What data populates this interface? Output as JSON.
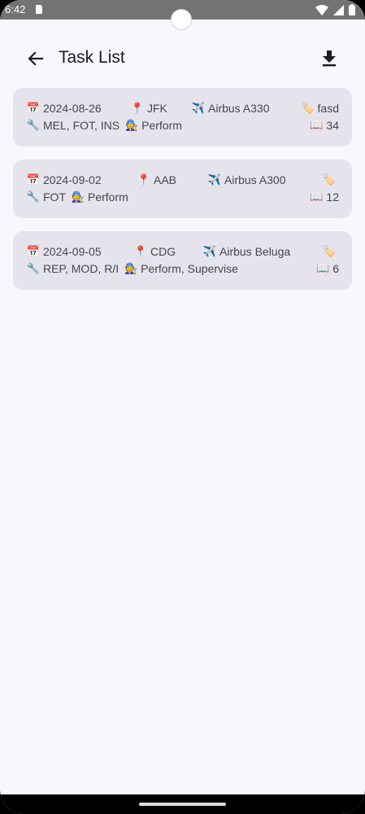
{
  "status_bar": {
    "time": "6:42"
  },
  "app_bar": {
    "title": "Task List",
    "back_icon": "arrow-left-icon",
    "download_icon": "download-icon"
  },
  "tasks": [
    {
      "date": "2024-08-26",
      "location": "JFK",
      "aircraft": "Airbus A330",
      "tag": "fasd",
      "categories": "MEL, FOT, INS",
      "roles": "Perform",
      "reference": "34"
    },
    {
      "date": "2024-09-02",
      "location": "AAB",
      "aircraft": "Airbus A300",
      "tag": "",
      "categories": "FOT",
      "roles": "Perform",
      "reference": "12"
    },
    {
      "date": "2024-09-05",
      "location": "CDG",
      "aircraft": "Airbus Beluga",
      "tag": "",
      "categories": "REP, MOD, R/I",
      "roles": "Perform, Supervise",
      "reference": "6"
    }
  ],
  "field_icons": {
    "date": "calendar-icon",
    "location": "pin-icon",
    "aircraft": "airplane-icon",
    "tag": "tag-icon",
    "categories": "wrench-icon",
    "roles": "mechanic-icon",
    "reference": "book-icon"
  },
  "colors": {
    "background": "#f8f7fd",
    "card": "#e5e3ec",
    "text": "#46464f",
    "status_bar": "#737373"
  }
}
